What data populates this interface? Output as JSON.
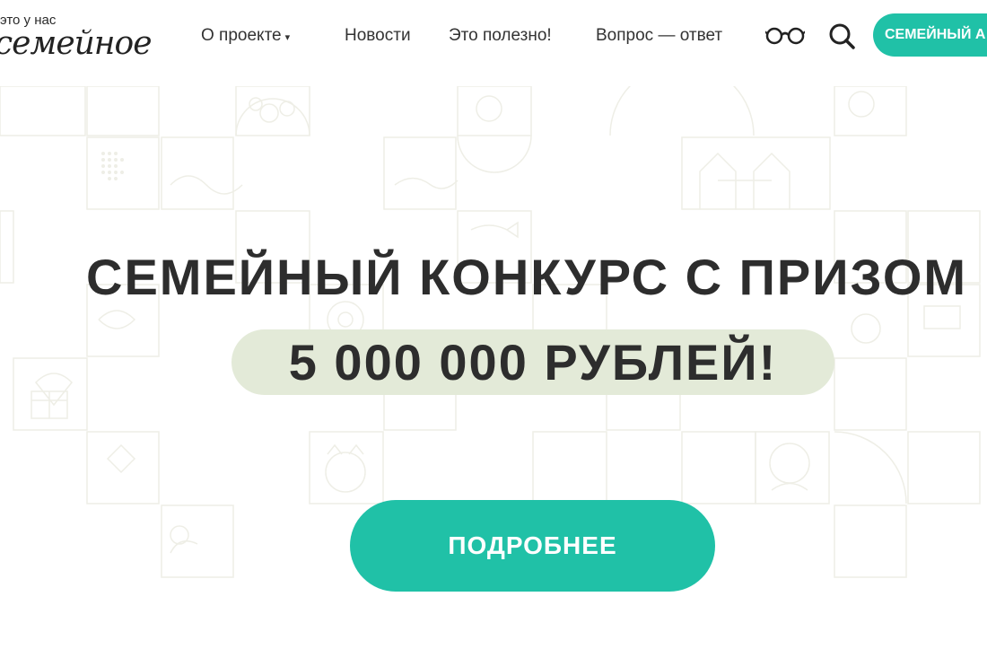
{
  "logo": {
    "top_line": "это у нас",
    "main_word": "семейное"
  },
  "nav": {
    "items": [
      {
        "label": "О проекте",
        "has_dropdown": true
      },
      {
        "label": "Новости"
      },
      {
        "label": "Это полезно!"
      },
      {
        "label": "Вопрос — ответ"
      }
    ],
    "icons": [
      "glasses-icon",
      "search-icon"
    ],
    "cta_label": "СЕМЕЙНЫЙ А"
  },
  "hero": {
    "title": "СЕМЕЙНЫЙ КОНКУРС С ПРИЗОМ",
    "amount": "5 000 000 РУБЛЕЙ!",
    "button_label": "ПОДРОБНЕЕ"
  },
  "colors": {
    "accent": "#20c1a7",
    "amount_highlight": "#e3ead8",
    "text_dark": "#2d2d2d",
    "pattern_line": "#efefe8"
  }
}
